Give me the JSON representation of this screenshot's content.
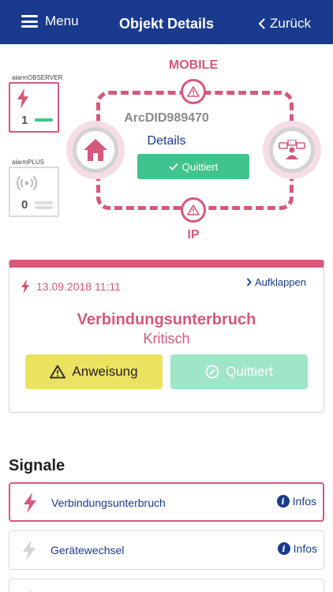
{
  "header": {
    "menu_label": "Menu",
    "title": "Objekt Details",
    "back_label": "Zurück"
  },
  "side_panels": [
    {
      "label": "alarmOBSERVER",
      "count": "1",
      "icon": "lightning-icon",
      "status_color": "#3cc48d"
    },
    {
      "label": "alarmPLUS",
      "count": "0",
      "icon": "wireless-icon",
      "status_color": "#dddddd"
    }
  ],
  "diagram": {
    "top_label": "MOBILE",
    "bottom_label": "IP",
    "arc_id": "ArcDID989470",
    "details_link": "Details",
    "quittiert_label": "Quittiert",
    "left_node_icon": "house-icon",
    "right_node_icon": "monitoring-station-icon"
  },
  "alarm": {
    "date": "13.09.2018 11:11",
    "expand_label": "Aufklappen",
    "title": "Verbindungsunterbruch",
    "severity": "Kritisch",
    "instruction_button": "Anweisung",
    "acknowledged_button": "Quittiert"
  },
  "signals": {
    "title": "Signale",
    "items": [
      {
        "label": "Verbindungsunterbruch",
        "info_label": "Infos",
        "active": true
      },
      {
        "label": "Gerätewechsel",
        "info_label": "Infos",
        "active": false
      }
    ]
  },
  "colors": {
    "brand": "#1a3a8f",
    "alert": "#d6587b",
    "success": "#40c48d",
    "warning": "#ebe360"
  }
}
